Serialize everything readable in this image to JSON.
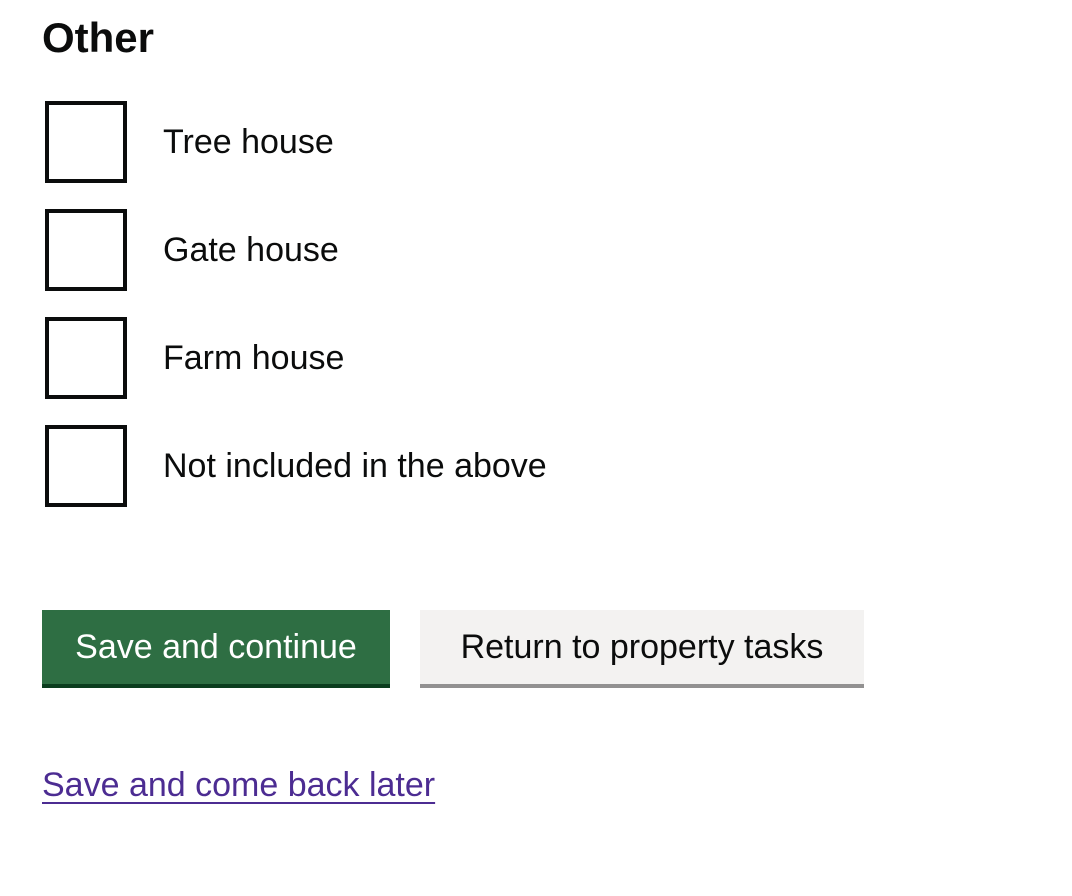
{
  "section": {
    "heading": "Other"
  },
  "checkboxes": [
    {
      "label": "Tree house",
      "checked": false
    },
    {
      "label": "Gate house",
      "checked": false
    },
    {
      "label": "Farm house",
      "checked": false
    },
    {
      "label": "Not included in the above",
      "checked": false
    }
  ],
  "actions": {
    "primary_label": "Save and continue",
    "secondary_label": "Return to property tasks",
    "later_link": "Save and come back later"
  },
  "colors": {
    "primary_button": "#2e6e43",
    "secondary_button": "#f3f2f1",
    "link": "#4c2c92",
    "text": "#0b0c0c"
  }
}
